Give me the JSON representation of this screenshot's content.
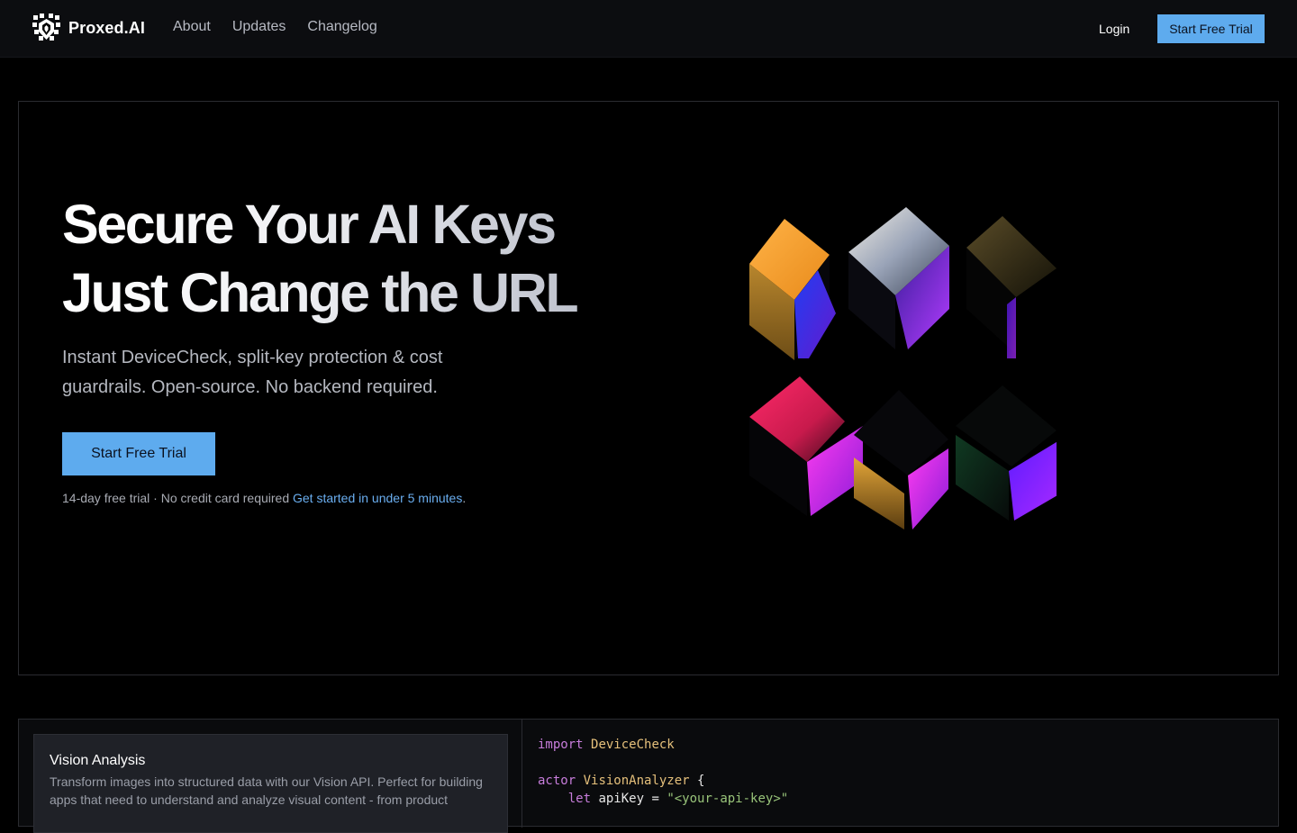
{
  "header": {
    "brand_name": "Proxed.AI",
    "nav": [
      "About",
      "Updates",
      "Changelog"
    ],
    "login_label": "Login",
    "cta_label": "Start Free Trial"
  },
  "hero": {
    "title_line1": "Secure Your AI Keys",
    "title_line2": "Just Change the URL",
    "subtitle": "Instant DeviceCheck, split-key protection & cost guardrails. Open-source. No backend required.",
    "cta_label": "Start Free Trial",
    "note_text": "14-day free trial · No credit card required ",
    "note_link": "Get started in under 5 minutes",
    "note_end": "."
  },
  "features": {
    "card_title": "Vision Analysis",
    "card_desc": "Transform images into structured data with our Vision API. Perfect for building apps that need to understand and analyze visual content - from product"
  },
  "code": {
    "line1_kw": "import",
    "line1_type": "DeviceCheck",
    "line3_kw": "actor",
    "line3_type": "VisionAnalyzer",
    "line3_brace": "{",
    "line4_kw": "let",
    "line4_name": "apiKey =",
    "line4_str": "\"<your-api-key>\""
  },
  "colors": {
    "accent": "#5eabee",
    "background": "#000000",
    "nav_bg": "#0c0d10",
    "card_bg": "#1f2127",
    "link": "#6aaef0"
  },
  "icons": {
    "brand_logo": "shield-logo-icon"
  }
}
